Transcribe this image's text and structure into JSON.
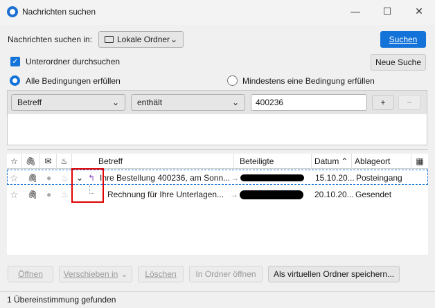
{
  "window": {
    "title": "Nachrichten suchen",
    "minimize_glyph": "—",
    "maximize_glyph": "☐",
    "close_glyph": "✕"
  },
  "search_in": {
    "label": "Nachrichten suchen in:",
    "folder": "Lokale Ordner",
    "search_button": "Suchen"
  },
  "options": {
    "subfolders_label": "Unterordner durchsuchen",
    "subfolders_checked": true,
    "new_search_button": "Neue Suche",
    "match_all_label": "Alle Bedingungen erfüllen",
    "match_any_label": "Mindestens eine Bedingung erfüllen",
    "selected": "all"
  },
  "criteria": {
    "field": "Betreff",
    "operator": "enthält",
    "value": "400236",
    "add_label": "+",
    "remove_label": "−"
  },
  "columns": {
    "subject": "Betreff",
    "participants": "Beteiligte",
    "date": "Datum",
    "location": "Ablageort"
  },
  "messages": [
    {
      "subject": "Ihre Bestellung 400236, am Sonn...",
      "date": "15.10.20...",
      "location": "Posteingang"
    },
    {
      "subject": "Rechnung für Ihre Unterlagen...",
      "date": "20.10.20...",
      "location": "Gesendet"
    }
  ],
  "actions": {
    "open": "Öffnen",
    "move_to": "Verschieben in",
    "delete": "Löschen",
    "open_in_folder": "In Ordner öffnen",
    "save_virtual": "Als virtuellen Ordner speichern..."
  },
  "status": "1 Übereinstimmung gefunden",
  "colors": {
    "accent": "#1373d9",
    "highlight_box": "#e00000",
    "reply_arrow": "#8a4cc9"
  }
}
